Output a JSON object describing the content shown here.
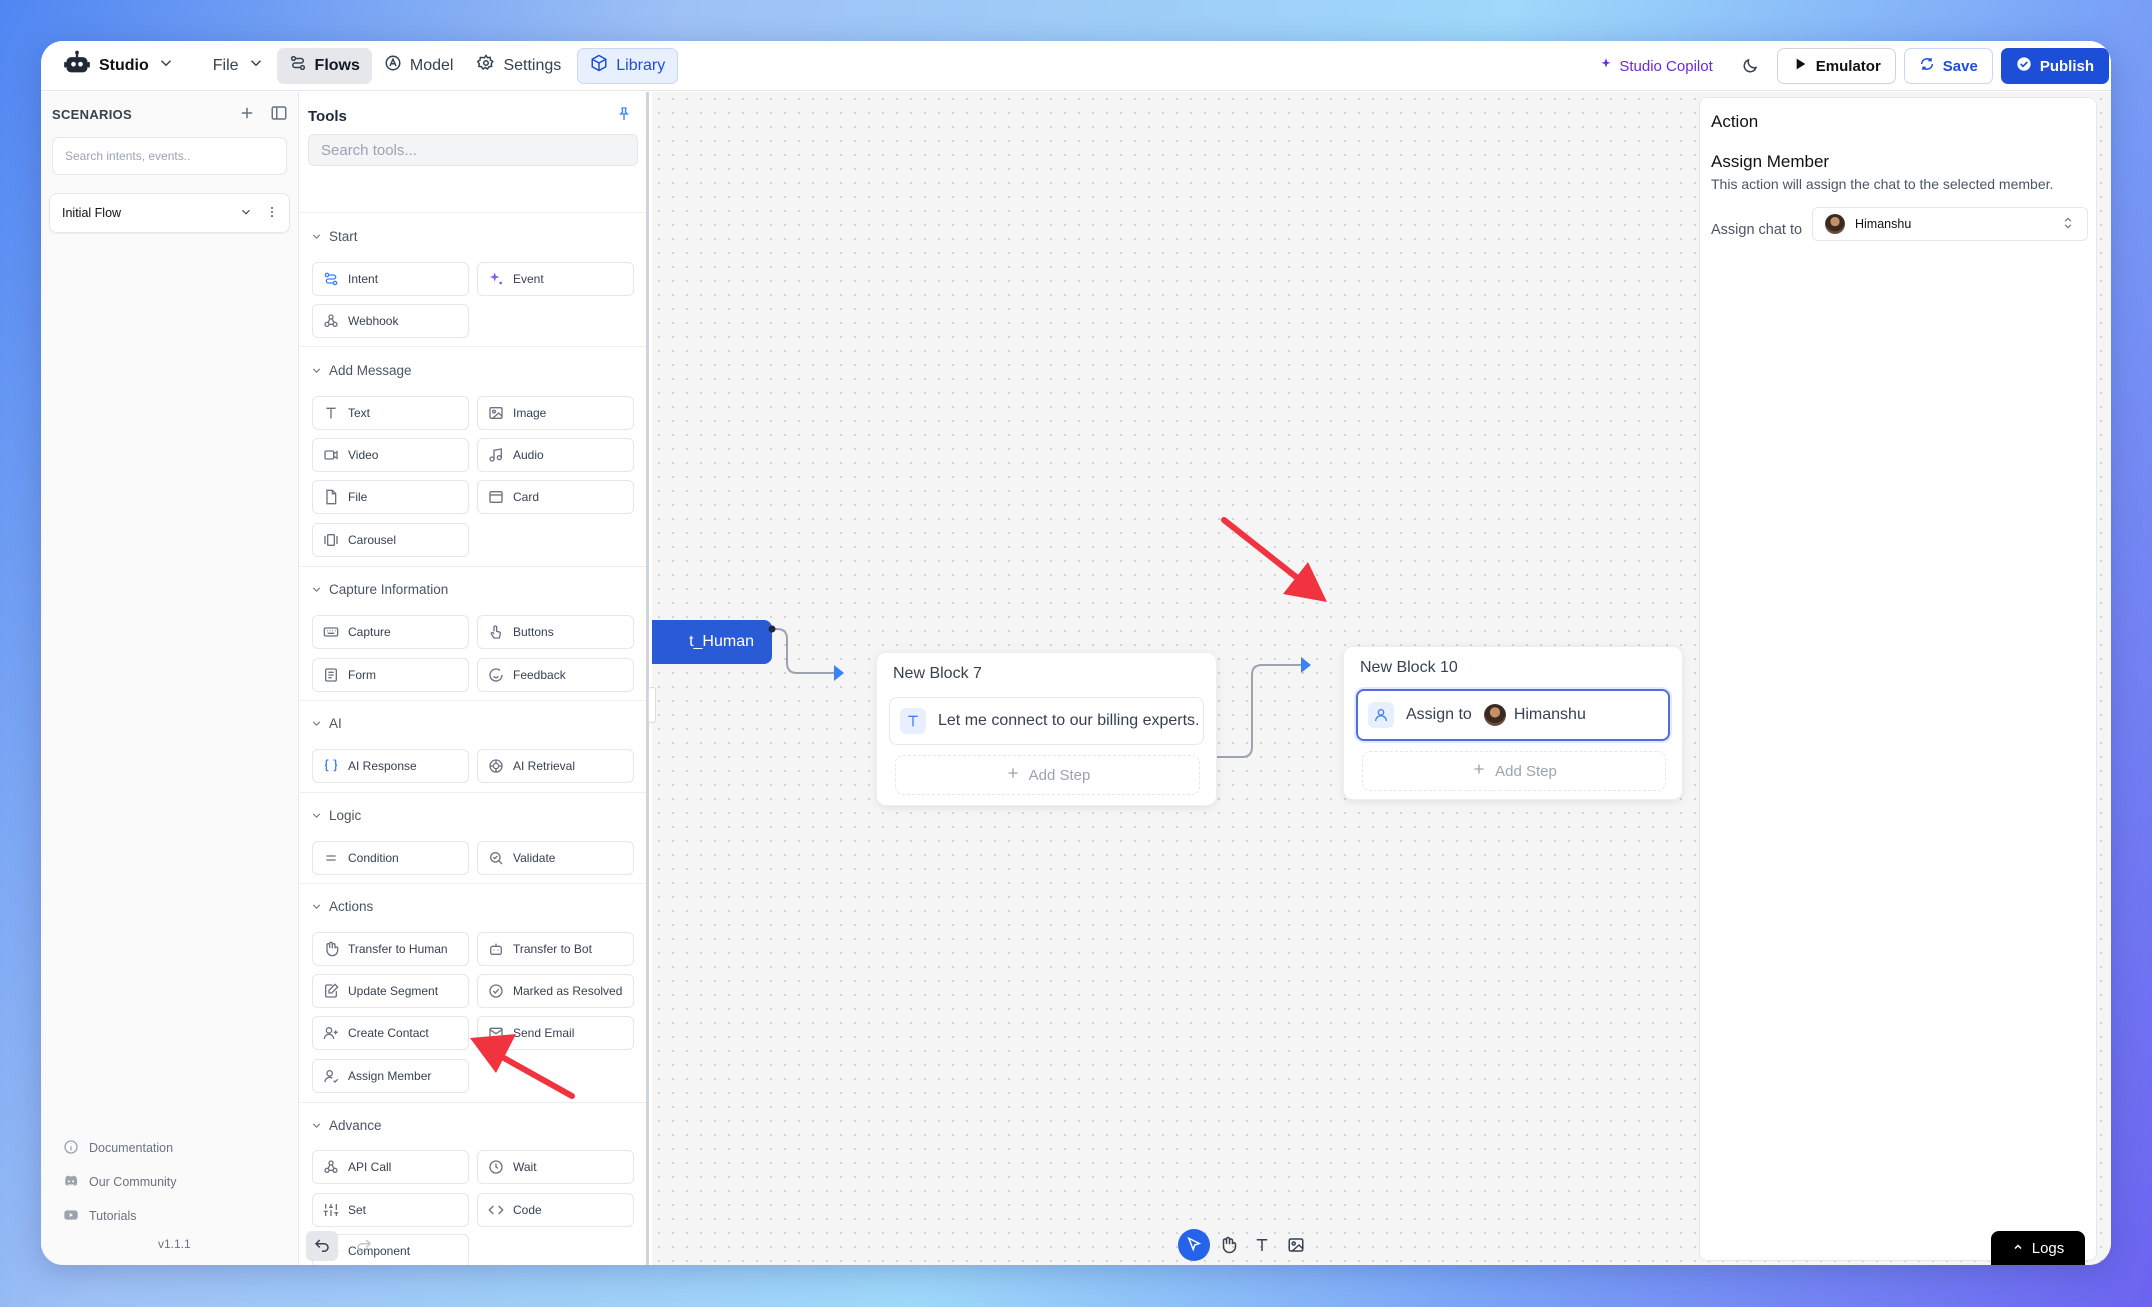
{
  "topbar": {
    "brand": "Studio",
    "menu": [
      {
        "label": "File"
      },
      {
        "label": "Flows"
      },
      {
        "label": "Model"
      },
      {
        "label": "Settings"
      },
      {
        "label": "Library"
      }
    ],
    "copilot": "Studio Copilot",
    "emulator": "Emulator",
    "save": "Save",
    "publish": "Publish"
  },
  "scenarios": {
    "title": "SCENARIOS",
    "search_placeholder": "Search intents, events..",
    "flow": "Initial Flow",
    "footer": [
      "Documentation",
      "Our Community",
      "Tutorials"
    ],
    "version": "v1.1.1"
  },
  "tools": {
    "title": "Tools",
    "search_placeholder": "Search tools...",
    "sections": [
      {
        "title": "Start",
        "items": [
          "Intent",
          "Event",
          "Webhook"
        ]
      },
      {
        "title": "Add Message",
        "items": [
          "Text",
          "Image",
          "Video",
          "Audio",
          "File",
          "Card",
          "Carousel"
        ]
      },
      {
        "title": "Capture Information",
        "items": [
          "Capture",
          "Buttons",
          "Form",
          "Feedback"
        ]
      },
      {
        "title": "AI",
        "items": [
          "AI Response",
          "AI Retrieval"
        ]
      },
      {
        "title": "Logic",
        "items": [
          "Condition",
          "Validate"
        ]
      },
      {
        "title": "Actions",
        "items": [
          "Transfer to Human",
          "Transfer to Bot",
          "Update Segment",
          "Marked as Resolved",
          "Create Contact",
          "Send Email",
          "Assign Member"
        ]
      },
      {
        "title": "Advance",
        "items": [
          "API Call",
          "Wait",
          "Set",
          "Code",
          "Component"
        ]
      }
    ]
  },
  "canvas": {
    "transfer_label": "t_Human",
    "block7": {
      "title": "New Block 7",
      "step": "Let me connect to our billing experts.",
      "add": "Add Step"
    },
    "block10": {
      "title": "New Block 10",
      "assign": "Assign to",
      "member": "Himanshu",
      "add": "Add Step"
    }
  },
  "panel": {
    "header": "Action",
    "title": "Assign Member",
    "desc": "This action will assign the chat to the selected member.",
    "assign_label": "Assign chat to",
    "member": "Himanshu"
  },
  "logs": "Logs",
  "colors": {
    "primary": "#1d4ed8",
    "copilot": "#6d28d9",
    "arrow": "#f0333f"
  }
}
